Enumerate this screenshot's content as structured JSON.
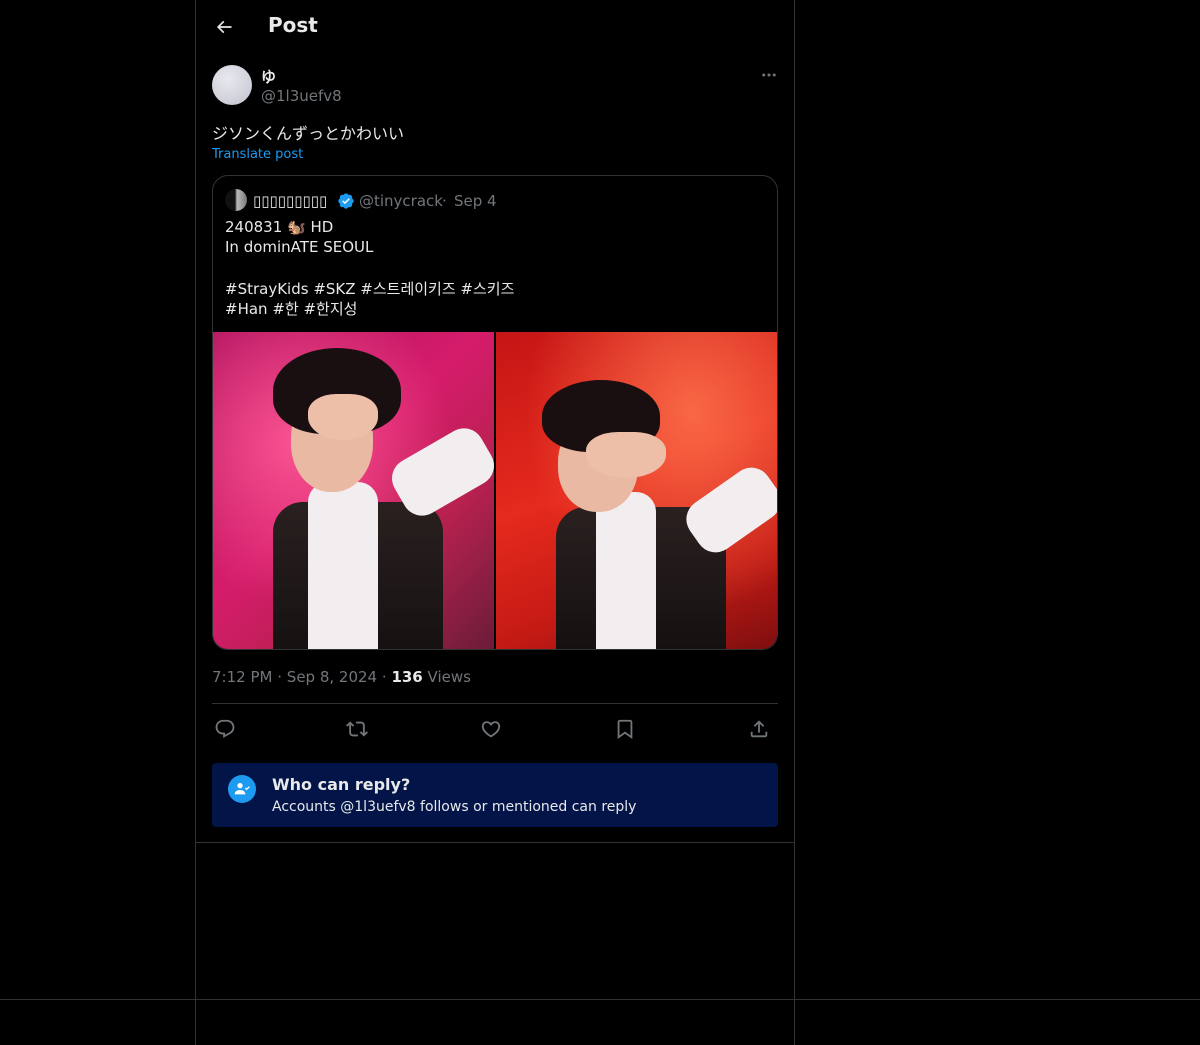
{
  "header": {
    "title": "Post"
  },
  "post": {
    "display_name": "ゆ",
    "handle": "@1l3uefv8",
    "text": "ジソンくんずっとかわいい",
    "translate_label": "Translate post",
    "time": "7:12 PM",
    "separator": "·",
    "date": "Sep 8, 2024",
    "views_count": "136",
    "views_label": "Views"
  },
  "quote": {
    "display_name": "▯▯▯▯▯▯▯▯▯",
    "handle": "@tinycrack",
    "separator": "·",
    "date": "Sep 4",
    "lines": [
      "240831 🐿️ HD",
      "In dominATE SEOUL",
      "#StrayKids #SKZ #스트레이키즈 #스키즈",
      "#Han #한 #한지성"
    ]
  },
  "reply_restriction": {
    "title": "Who can reply?",
    "subtitle": "Accounts @1l3uefv8 follows or mentioned can reply"
  },
  "colors": {
    "background": "#000000",
    "border": "#2f3336",
    "text_primary": "#e7e9ea",
    "text_secondary": "#71767b",
    "accent": "#1d9bf0",
    "reply_box_bg": "#031448"
  },
  "icons": {
    "back": "arrow-left-icon",
    "more": "more-horizontal-icon",
    "verified": "verified-badge-icon",
    "reply": "reply-icon",
    "repost": "repost-icon",
    "like": "heart-icon",
    "bookmark": "bookmark-icon",
    "share": "share-icon",
    "reply_restriction": "user-mention-icon"
  }
}
